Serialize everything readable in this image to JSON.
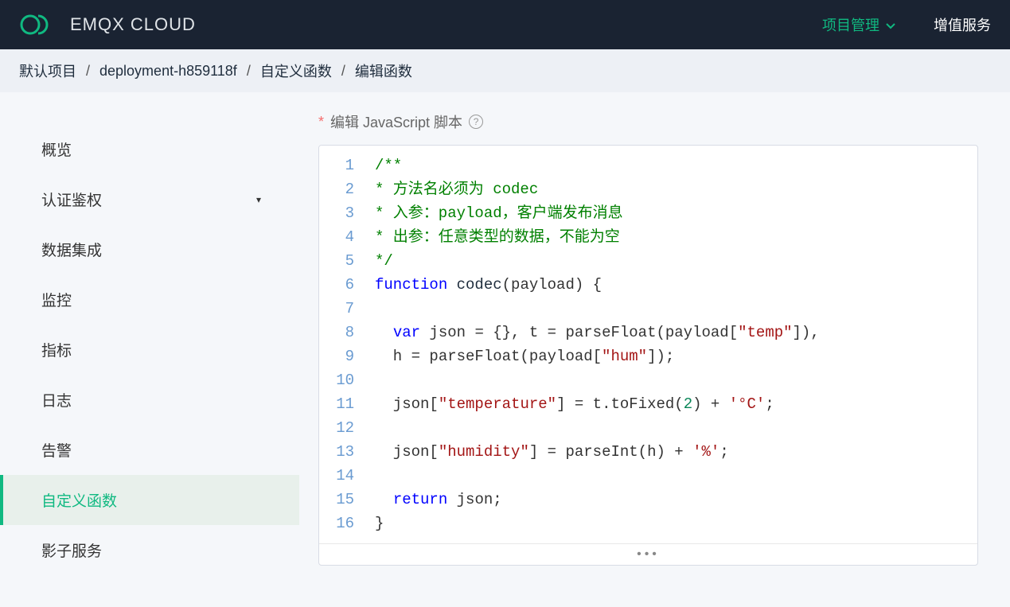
{
  "header": {
    "brand": "EMQX CLOUD",
    "nav_project": "项目管理",
    "nav_services": "增值服务"
  },
  "breadcrumb": [
    "默认项目",
    "deployment-h859118f",
    "自定义函数",
    "编辑函数"
  ],
  "sidebar": {
    "items": [
      {
        "label": "概览",
        "expandable": false
      },
      {
        "label": "认证鉴权",
        "expandable": true
      },
      {
        "label": "数据集成",
        "expandable": false
      },
      {
        "label": "监控",
        "expandable": false
      },
      {
        "label": "指标",
        "expandable": false
      },
      {
        "label": "日志",
        "expandable": false
      },
      {
        "label": "告警",
        "expandable": false
      },
      {
        "label": "自定义函数",
        "expandable": false,
        "active": true
      },
      {
        "label": "影子服务",
        "expandable": false
      }
    ]
  },
  "editor": {
    "label": "编辑 JavaScript 脚本",
    "line_count": 16,
    "code_tokens": [
      [
        {
          "t": "/**",
          "c": "c-comment"
        }
      ],
      [
        {
          "t": "* 方法名必须为 codec",
          "c": "c-comment"
        }
      ],
      [
        {
          "t": "* 入参：payload，客户端发布消息",
          "c": "c-comment"
        }
      ],
      [
        {
          "t": "* 出参：任意类型的数据，不能为空",
          "c": "c-comment"
        }
      ],
      [
        {
          "t": "*/",
          "c": "c-comment"
        }
      ],
      [
        {
          "t": "function",
          "c": "c-keyword"
        },
        {
          "t": " ",
          "c": ""
        },
        {
          "t": "codec",
          "c": "c-func"
        },
        {
          "t": "(payload) {",
          "c": ""
        }
      ],
      [],
      [
        {
          "t": "  ",
          "c": ""
        },
        {
          "t": "var",
          "c": "c-keyword"
        },
        {
          "t": " json = {}, t = parseFloat(payload[",
          "c": ""
        },
        {
          "t": "\"temp\"",
          "c": "c-string"
        },
        {
          "t": "]),",
          "c": ""
        }
      ],
      [
        {
          "t": "  h = parseFloat(payload[",
          "c": ""
        },
        {
          "t": "\"hum\"",
          "c": "c-string"
        },
        {
          "t": "]);",
          "c": ""
        }
      ],
      [],
      [
        {
          "t": "  json[",
          "c": ""
        },
        {
          "t": "\"temperature\"",
          "c": "c-string"
        },
        {
          "t": "] = t.toFixed(",
          "c": ""
        },
        {
          "t": "2",
          "c": "c-num"
        },
        {
          "t": ") + ",
          "c": ""
        },
        {
          "t": "'°C'",
          "c": "c-string"
        },
        {
          "t": ";",
          "c": ""
        }
      ],
      [],
      [
        {
          "t": "  json[",
          "c": ""
        },
        {
          "t": "\"humidity\"",
          "c": "c-string"
        },
        {
          "t": "] = parseInt(h) + ",
          "c": ""
        },
        {
          "t": "'%'",
          "c": "c-string"
        },
        {
          "t": ";",
          "c": ""
        }
      ],
      [],
      [
        {
          "t": "  ",
          "c": ""
        },
        {
          "t": "return",
          "c": "c-keyword"
        },
        {
          "t": " json;",
          "c": ""
        }
      ],
      [
        {
          "t": "}",
          "c": ""
        }
      ]
    ]
  }
}
